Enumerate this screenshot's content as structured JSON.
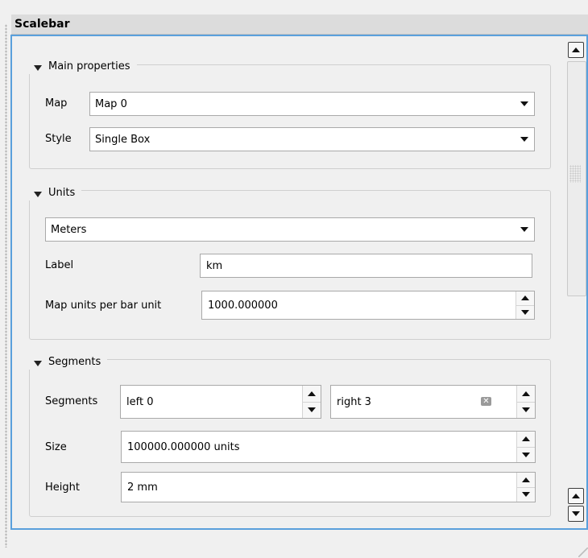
{
  "title": "Scalebar",
  "main_properties": {
    "group_title": "Main properties",
    "map_label": "Map",
    "map_value": "Map 0",
    "style_label": "Style",
    "style_value": "Single Box"
  },
  "units": {
    "group_title": "Units",
    "units_value": "Meters",
    "label_label": "Label",
    "label_value": "km",
    "map_units_label": "Map units per bar unit",
    "map_units_value": "1000.000000"
  },
  "segments": {
    "group_title": "Segments",
    "segments_label": "Segments",
    "left_value": "left 0",
    "right_value": "right 3",
    "size_label": "Size",
    "size_value": "100000.000000 units",
    "height_label": "Height",
    "height_value": "2 mm"
  }
}
